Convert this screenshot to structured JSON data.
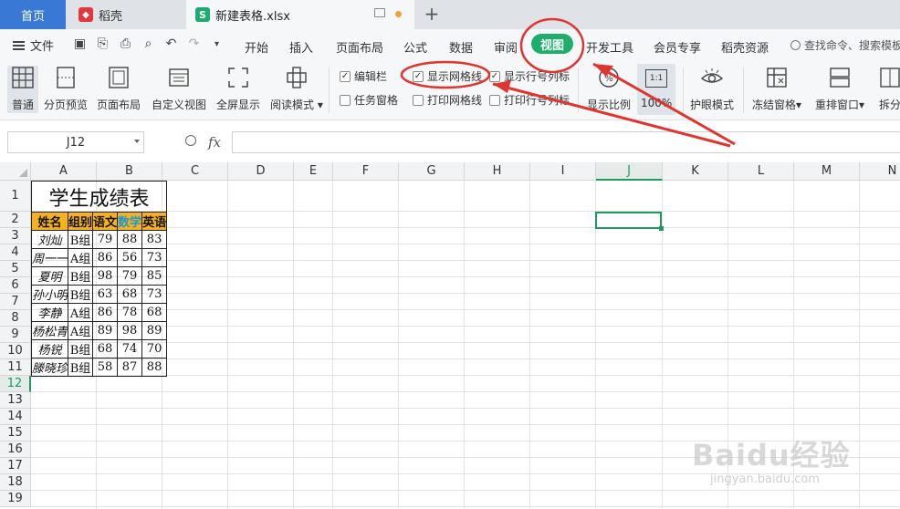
{
  "tabs": {
    "home": "首页",
    "daoke": "稻壳",
    "file": "新建表格.xlsx",
    "file_icon": "S",
    "new_tab": "+"
  },
  "menu": {
    "file": "文件",
    "items": [
      "开始",
      "插入",
      "页面布局",
      "公式",
      "数据",
      "审阅",
      "视图",
      "开发工具",
      "会员专享",
      "稻壳资源"
    ],
    "search": "查找命令、搜索模板"
  },
  "ribbon": {
    "normal": "普通",
    "page_break": "分页预览",
    "page_layout": "页面布局",
    "custom_view": "自定义视图",
    "fullscreen": "全屏显示",
    "reading_mode": "阅读模式",
    "checks": {
      "formula_bar": {
        "label": "编辑栏",
        "checked": true
      },
      "show_gridlines": {
        "label": "显示网格线",
        "checked": true
      },
      "show_headings": {
        "label": "显示行号列标",
        "checked": true
      },
      "task_pane": {
        "label": "任务窗格",
        "checked": false
      },
      "print_gridlines": {
        "label": "打印网格线",
        "checked": false
      },
      "print_headings": {
        "label": "打印行号列标",
        "checked": false
      }
    },
    "zoom_ratio": "显示比例",
    "zoom_100_icon": "1:1",
    "zoom_100": "100%",
    "eye_mode": "护眼模式",
    "freeze": "冻结窗格",
    "arrange": "重排窗口",
    "split": "拆分"
  },
  "formula_bar": {
    "cell_ref": "J12",
    "fx": "fx",
    "value": ""
  },
  "grid": {
    "columns": [
      "A",
      "B",
      "C",
      "D",
      "E",
      "F",
      "G",
      "H",
      "I",
      "J",
      "K",
      "L",
      "M",
      "N"
    ],
    "rows": [
      "1",
      "2",
      "3",
      "4",
      "5",
      "6",
      "7",
      "8",
      "9",
      "10",
      "11",
      "12",
      "13",
      "14",
      "15",
      "16",
      "17",
      "18",
      "19"
    ],
    "selected_col": "J",
    "selected_row": "12"
  },
  "sheet": {
    "title": "学生成绩表",
    "headers": [
      "姓名",
      "组别",
      "语文",
      "数学",
      "英语"
    ],
    "rows": [
      [
        "刘灿",
        "B组",
        "79",
        "88",
        "83"
      ],
      [
        "周一一",
        "A组",
        "86",
        "56",
        "73"
      ],
      [
        "夏明",
        "B组",
        "98",
        "79",
        "85"
      ],
      [
        "孙小明",
        "B组",
        "63",
        "68",
        "73"
      ],
      [
        "李静",
        "A组",
        "86",
        "78",
        "68"
      ],
      [
        "杨松青",
        "A组",
        "89",
        "98",
        "89"
      ],
      [
        "杨锐",
        "B组",
        "68",
        "74",
        "70"
      ],
      [
        "滕晓珍",
        "B组",
        "58",
        "87",
        "88"
      ]
    ]
  },
  "watermark": {
    "brand": "Baidu经验",
    "url": "jingyan.baidu.com"
  },
  "colors": {
    "accent_green": "#1fae6a",
    "annotation_red": "#e0342f",
    "header_fill": "#f5b120",
    "math_header": "#1a9bd0"
  }
}
